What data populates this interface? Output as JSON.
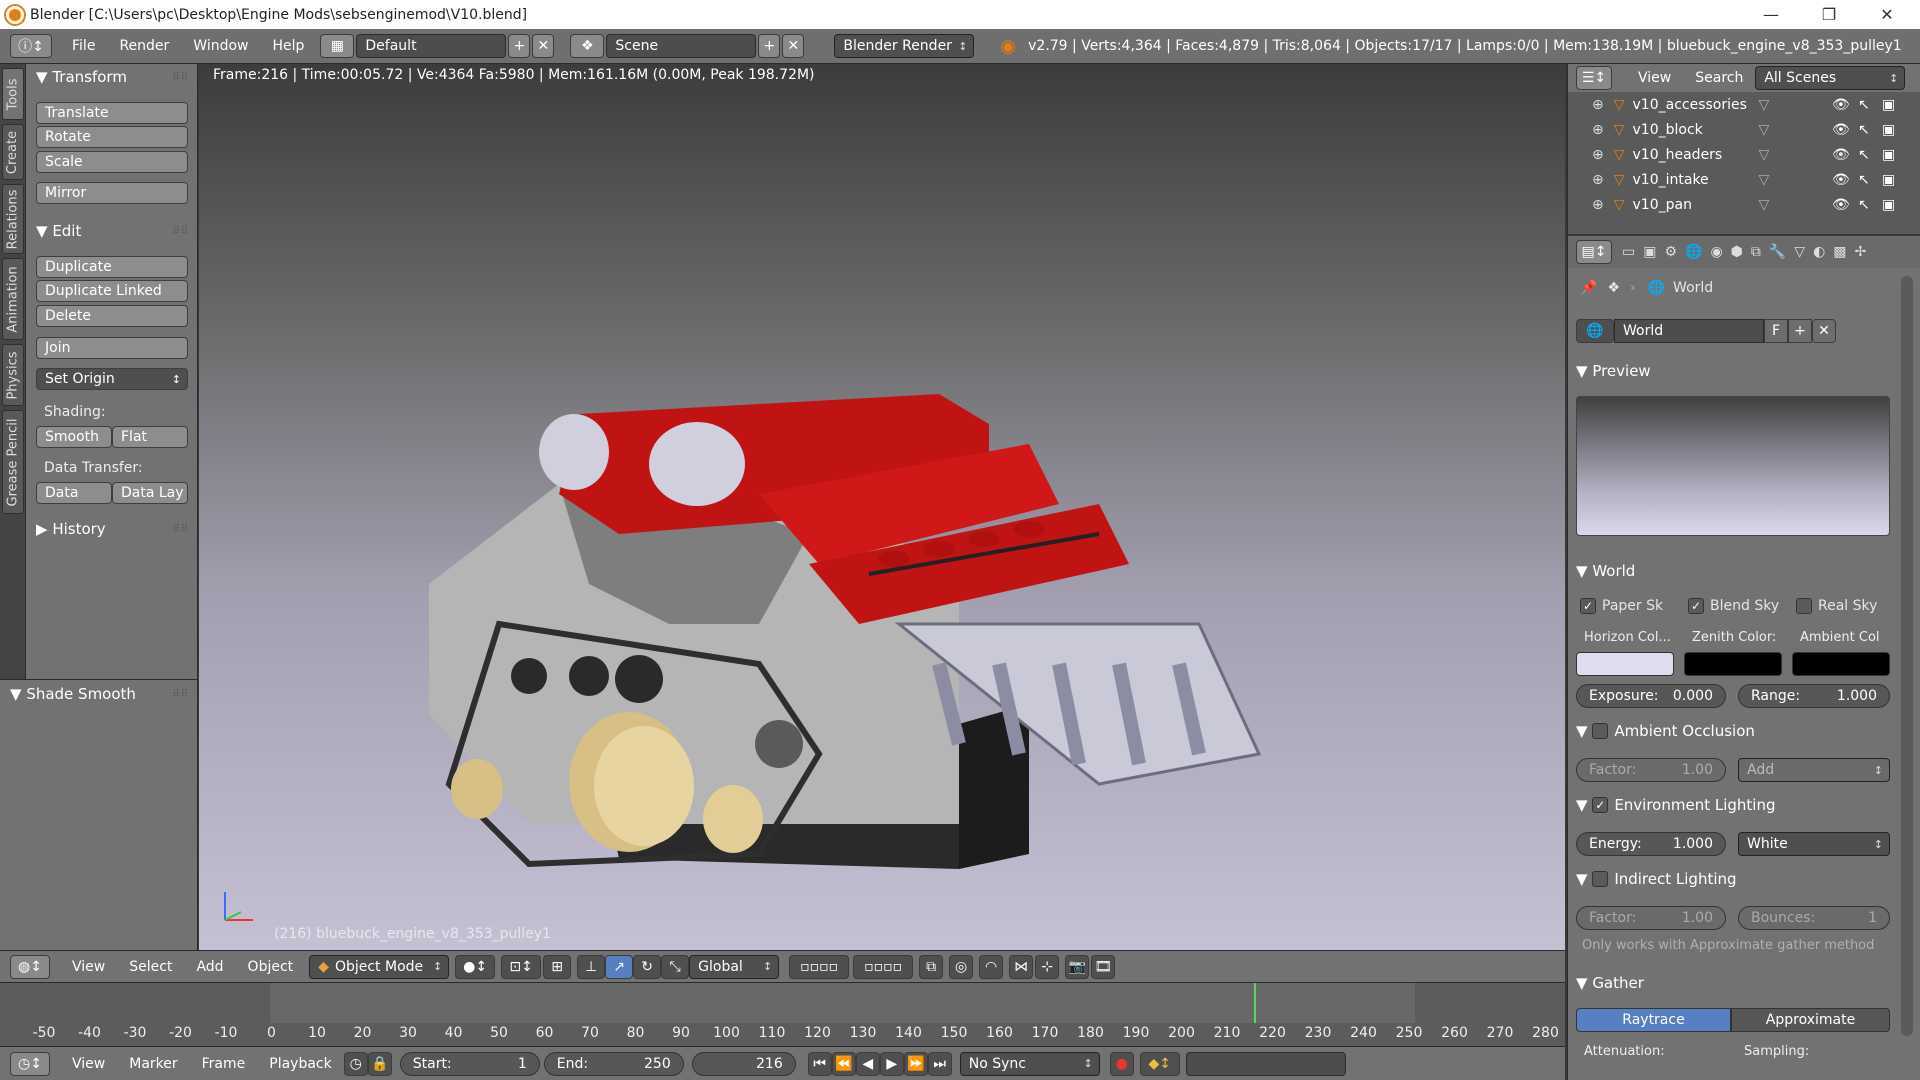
{
  "window": {
    "title": "Blender [C:\\Users\\pc\\Desktop\\Engine Mods\\sebsenginemod\\V10.blend]",
    "minimize": "—",
    "maximize": "❐",
    "close": "✕"
  },
  "infobar": {
    "menus": [
      "File",
      "Render",
      "Window",
      "Help"
    ],
    "layout": "Default",
    "scene": "Scene",
    "engine": "Blender Render",
    "stats": "v2.79 | Verts:4,364 | Faces:4,879 | Tris:8,064 | Objects:17/17 | Lamps:0/0 | Mem:138.19M | bluebuck_engine_v8_353_pulley1"
  },
  "tabs": [
    "Tools",
    "Create",
    "Relations",
    "Animation",
    "Physics",
    "Grease Pencil"
  ],
  "toolshelf": {
    "transform_title": "Transform",
    "translate": "Translate",
    "rotate": "Rotate",
    "scale": "Scale",
    "mirror": "Mirror",
    "edit_title": "Edit",
    "duplicate": "Duplicate",
    "duplicate_linked": "Duplicate Linked",
    "delete": "Delete",
    "join": "Join",
    "set_origin": "Set Origin",
    "shading_label": "Shading:",
    "smooth": "Smooth",
    "flat": "Flat",
    "data_transfer_label": "Data Transfer:",
    "data": "Data",
    "data_lay": "Data Lay",
    "history_title": "History"
  },
  "redo": {
    "title": "Shade Smooth"
  },
  "viewport": {
    "info": "Frame:216 | Time:00:05.72 | Ve:4364 Fa:5980 | Mem:161.16M (0.00M, Peak 198.72M)",
    "object": "(216) bluebuck_engine_v8_353_pulley1"
  },
  "vpheader": {
    "view": "View",
    "select": "Select",
    "add": "Add",
    "object": "Object",
    "mode": "Object Mode",
    "orientation": "Global"
  },
  "timeline": {
    "ticks": [
      "-50",
      "-40",
      "-30",
      "-20",
      "-10",
      "0",
      "10",
      "20",
      "30",
      "40",
      "50",
      "60",
      "70",
      "80",
      "90",
      "100",
      "110",
      "120",
      "130",
      "140",
      "150",
      "160",
      "170",
      "180",
      "190",
      "200",
      "210",
      "220",
      "230",
      "240",
      "250",
      "260",
      "270",
      "280"
    ],
    "current_frame": 216
  },
  "tlheader": {
    "view": "View",
    "marker": "Marker",
    "frame": "Frame",
    "playback": "Playback",
    "start_label": "Start:",
    "start": "1",
    "end_label": "End:",
    "end": "250",
    "current": "216",
    "sync": "No Sync"
  },
  "outliner": {
    "view": "View",
    "search": "Search",
    "filter": "All Scenes",
    "items": [
      "v10_accessories",
      "v10_block",
      "v10_headers",
      "v10_intake",
      "v10_pan"
    ]
  },
  "props": {
    "context": "World",
    "world_name": "World",
    "f": "F",
    "preview_title": "Preview",
    "world_title": "World",
    "paper_sky": "Paper Sk",
    "blend_sky": "Blend Sky",
    "real_sky": "Real Sky",
    "horizon_label": "Horizon Col...",
    "zenith_label": "Zenith Color:",
    "ambient_label": "Ambient Col",
    "horizon_color": "#e0dcf0",
    "zenith_color": "#000000",
    "ambient_color": "#000000",
    "exposure_label": "Exposure:",
    "exposure": "0.000",
    "range_label": "Range:",
    "range": "1.000",
    "ao_title": "Ambient Occlusion",
    "ao_factor_label": "Factor:",
    "ao_factor": "1.00",
    "ao_mode": "Add",
    "env_title": "Environment Lighting",
    "energy_label": "Energy:",
    "energy": "1.000",
    "env_color": "White",
    "indirect_title": "Indirect Lighting",
    "ind_factor_label": "Factor:",
    "ind_factor": "1.00",
    "bounces_label": "Bounces:",
    "bounces": "1",
    "approx_note": "Only works with Approximate gather method",
    "gather_title": "Gather",
    "raytrace": "Raytrace",
    "approximate": "Approximate",
    "attenuation_label": "Attenuation:",
    "sampling_label": "Sampling:"
  }
}
